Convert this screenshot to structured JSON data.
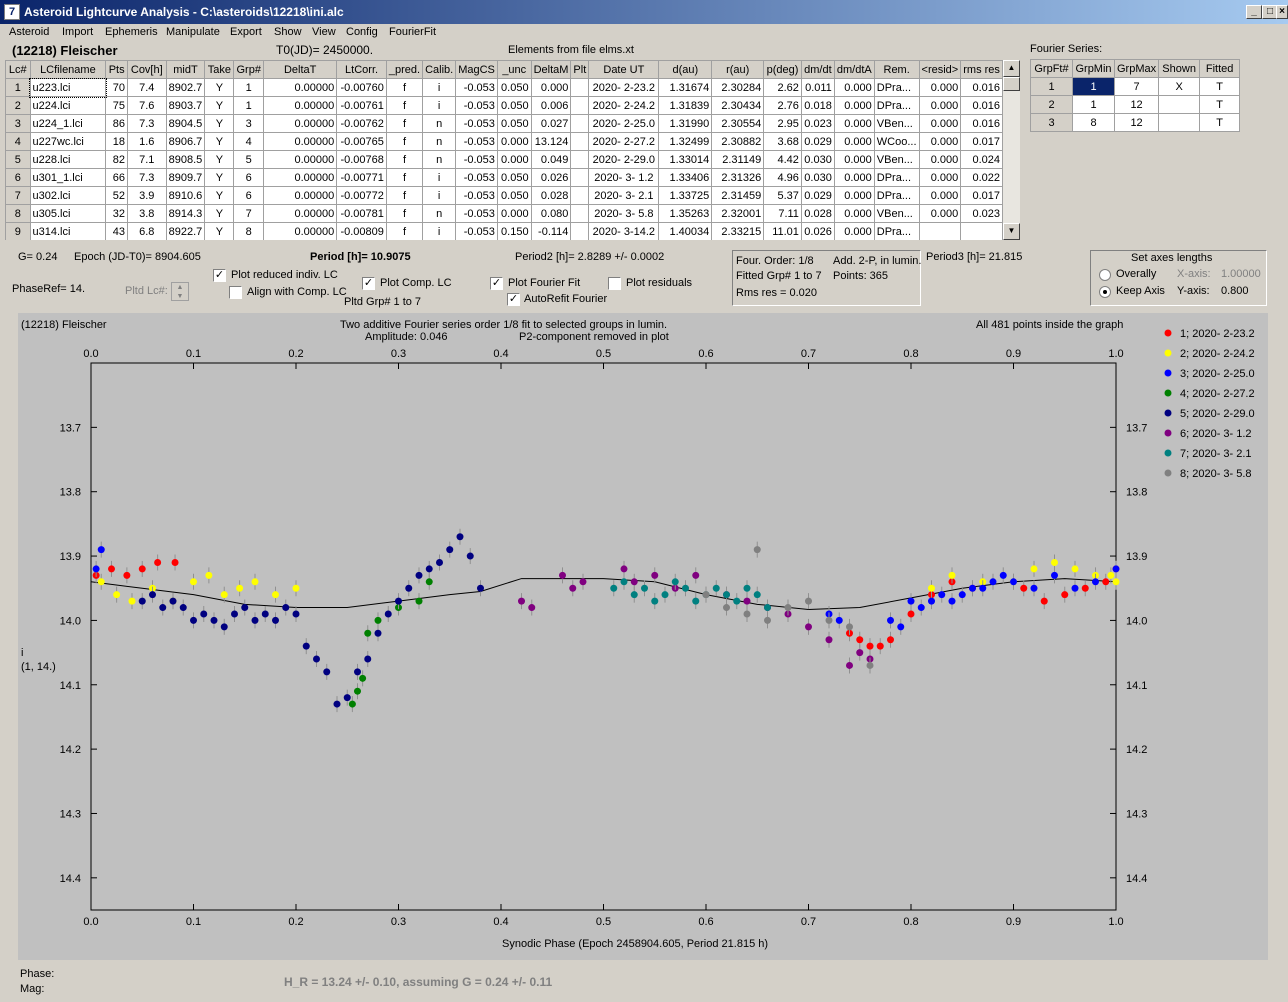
{
  "window": {
    "title": "Asteroid Lightcurve Analysis - C:\\asteroids\\12218\\ini.alc",
    "icon": "7"
  },
  "menu": [
    "Asteroid",
    "Import",
    "Ephemeris",
    "Manipulate",
    "Export",
    "Show",
    "View",
    "Config",
    "FourierFit"
  ],
  "header": {
    "asteroid": "(12218) Fleischer",
    "t0": "T0(JD)= 2450000.",
    "elements": "Elements from file elms.xt"
  },
  "lc_table": {
    "columns": [
      "Lc#",
      "LCfilename",
      "Pts",
      "Cov[h]",
      "midT",
      "Take",
      "Grp#",
      "DeltaT",
      "LtCorr.",
      "_pred.",
      "Calib.",
      "MagCS",
      "_unc",
      "DeltaM",
      "Plt",
      "Date UT",
      "d(au)",
      "r(au)",
      "p(deg)",
      "dm/dt",
      "dm/dtA",
      "Rem.",
      "<resid>",
      "rms res"
    ],
    "rows": [
      [
        "1",
        "u223.lci",
        "70",
        "7.4",
        "8902.7",
        "Y",
        "1",
        "0.00000",
        "-0.00760",
        "f",
        "i",
        "-0.053",
        "0.050",
        "0.000",
        "",
        "2020- 2-23.2",
        "1.31674",
        "2.30284",
        "2.62",
        "0.011",
        "0.000",
        "DPra...",
        "0.000",
        "0.016"
      ],
      [
        "2",
        "u224.lci",
        "75",
        "7.6",
        "8903.7",
        "Y",
        "1",
        "0.00000",
        "-0.00761",
        "f",
        "i",
        "-0.053",
        "0.050",
        "0.006",
        "",
        "2020- 2-24.2",
        "1.31839",
        "2.30434",
        "2.76",
        "0.018",
        "0.000",
        "DPra...",
        "0.000",
        "0.016"
      ],
      [
        "3",
        "u224_1.lci",
        "86",
        "7.3",
        "8904.5",
        "Y",
        "3",
        "0.00000",
        "-0.00762",
        "f",
        "n",
        "-0.053",
        "0.050",
        "0.027",
        "",
        "2020- 2-25.0",
        "1.31990",
        "2.30554",
        "2.95",
        "0.023",
        "0.000",
        "VBen...",
        "0.000",
        "0.016"
      ],
      [
        "4",
        "u227wc.lci",
        "18",
        "1.6",
        "8906.7",
        "Y",
        "4",
        "0.00000",
        "-0.00765",
        "f",
        "n",
        "-0.053",
        "0.000",
        "13.124",
        "",
        "2020- 2-27.2",
        "1.32499",
        "2.30882",
        "3.68",
        "0.029",
        "0.000",
        "WCoo...",
        "0.000",
        "0.017"
      ],
      [
        "5",
        "u228.lci",
        "82",
        "7.1",
        "8908.5",
        "Y",
        "5",
        "0.00000",
        "-0.00768",
        "f",
        "n",
        "-0.053",
        "0.000",
        "0.049",
        "",
        "2020- 2-29.0",
        "1.33014",
        "2.31149",
        "4.42",
        "0.030",
        "0.000",
        "VBen...",
        "0.000",
        "0.024"
      ],
      [
        "6",
        "u301_1.lci",
        "66",
        "7.3",
        "8909.7",
        "Y",
        "6",
        "0.00000",
        "-0.00771",
        "f",
        "i",
        "-0.053",
        "0.050",
        "0.026",
        "",
        "2020- 3- 1.2",
        "1.33406",
        "2.31326",
        "4.96",
        "0.030",
        "0.000",
        "DPra...",
        "0.000",
        "0.022"
      ],
      [
        "7",
        "u302.lci",
        "52",
        "3.9",
        "8910.6",
        "Y",
        "6",
        "0.00000",
        "-0.00772",
        "f",
        "i",
        "-0.053",
        "0.050",
        "0.028",
        "",
        "2020- 3- 2.1",
        "1.33725",
        "2.31459",
        "5.37",
        "0.029",
        "0.000",
        "DPra...",
        "0.000",
        "0.017"
      ],
      [
        "8",
        "u305.lci",
        "32",
        "3.8",
        "8914.3",
        "Y",
        "7",
        "0.00000",
        "-0.00781",
        "f",
        "n",
        "-0.053",
        "0.000",
        "0.080",
        "",
        "2020- 3- 5.8",
        "1.35263",
        "2.32001",
        "7.11",
        "0.028",
        "0.000",
        "VBen...",
        "0.000",
        "0.023"
      ],
      [
        "9",
        "u314.lci",
        "43",
        "6.8",
        "8922.7",
        "Y",
        "8",
        "0.00000",
        "-0.00809",
        "f",
        "i",
        "-0.053",
        "0.150",
        "-0.114",
        "",
        "2020- 3-14.2",
        "1.40034",
        "2.33215",
        "11.01",
        "0.026",
        "0.000",
        "DPra...",
        "",
        ""
      ]
    ]
  },
  "fourier": {
    "title": "Fourier Series:",
    "columns": [
      "GrpFt#",
      "GrpMin",
      "GrpMax",
      "Shown",
      "Fitted"
    ],
    "rows": [
      [
        "1",
        "1",
        "7",
        "X",
        "T"
      ],
      [
        "2",
        "1",
        "12",
        "",
        "T"
      ],
      [
        "3",
        "8",
        "12",
        "",
        "T"
      ]
    ]
  },
  "controls": {
    "g": "G= 0.24",
    "epoch": "Epoch (JD-T0)= 8904.605",
    "period": "Period [h]= 10.9075",
    "period2": "Period2 [h]= 2.8289 +/- 0.0002",
    "period3": "Period3 [h]= 21.815",
    "phaseref": "PhaseRef= 14.",
    "pltd_lc": "Pltd Lc#:",
    "plot_reduced": "Plot reduced indiv. LC",
    "align_comp": "Align with Comp. LC",
    "plot_comp": "Plot Comp. LC",
    "pltd_grp": "Pltd Grp#  1   to   7",
    "plot_fourier": "Plot Fourier Fit",
    "autorefit": "AutoRefit Fourier",
    "plot_resid": "Plot residuals",
    "four_order": "Four. Order:  1/8",
    "add2p": "Add. 2-P, in lumin.",
    "fitted_grp": "Fitted Grp# 1 to 7",
    "points": "Points: 365",
    "rms": "Rms res      = 0.020",
    "axes_title": "Set axes lengths",
    "overall": "Overally",
    "keep": "Keep Axis",
    "xaxis_lbl": "X-axis:",
    "xaxis_val": "1.00000",
    "yaxis_lbl": "Y-axis:",
    "yaxis_val": "0.800"
  },
  "plot": {
    "name": "(12218) Fleischer",
    "line1": "Two additive Fourier series order 1/8 fit to selected groups in lumin.",
    "line2": "Amplitude: 0.046",
    "line3": "P2-component removed in plot",
    "inside": "All 481 points inside the graph",
    "xlabel": "Synodic Phase (Epoch 2458904.605, Period 21.815 h)",
    "ylabel1": "i",
    "ylabel2": "(1, 14.)"
  },
  "footer": {
    "phase": "Phase:",
    "mag": "Mag:",
    "hr": "H_R = 13.24 +/- 0.10, assuming G = 0.24 +/- 0.11"
  },
  "chart_data": {
    "type": "scatter",
    "xlim": [
      0,
      1
    ],
    "ylim": [
      13.6,
      14.45
    ],
    "y_inverted": true,
    "xticks": [
      0.0,
      0.1,
      0.2,
      0.3,
      0.4,
      0.5,
      0.6,
      0.7,
      0.8,
      0.9,
      1.0
    ],
    "yticks": [
      13.7,
      13.8,
      13.9,
      14.0,
      14.1,
      14.2,
      14.3,
      14.4
    ],
    "series": [
      {
        "name": "1; 2020- 2-23.2",
        "color": "#ff0000",
        "x": [
          0.005,
          0.02,
          0.035,
          0.05,
          0.065,
          0.082,
          0.8,
          0.82,
          0.84,
          0.86,
          0.75,
          0.76,
          0.77,
          0.78,
          0.74,
          0.95,
          0.97,
          0.99,
          1.0,
          0.93,
          0.91
        ],
        "y": [
          13.93,
          13.92,
          13.93,
          13.92,
          13.91,
          13.91,
          13.99,
          13.96,
          13.94,
          13.95,
          14.03,
          14.04,
          14.04,
          14.03,
          14.02,
          13.96,
          13.95,
          13.94,
          13.92,
          13.97,
          13.95
        ]
      },
      {
        "name": "2; 2020- 2-24.2",
        "color": "#ffff00",
        "x": [
          0.01,
          0.025,
          0.04,
          0.06,
          0.08,
          0.1,
          0.115,
          0.13,
          0.145,
          0.16,
          0.18,
          0.2,
          0.82,
          0.84,
          0.87,
          0.9,
          0.92,
          0.94,
          0.96,
          0.98,
          1.0,
          0.995
        ],
        "y": [
          13.94,
          13.96,
          13.97,
          13.95,
          13.97,
          13.94,
          13.93,
          13.96,
          13.95,
          13.94,
          13.96,
          13.95,
          13.95,
          13.93,
          13.94,
          13.94,
          13.92,
          13.91,
          13.92,
          13.93,
          13.94,
          13.93
        ]
      },
      {
        "name": "3; 2020- 2-25.0",
        "color": "#0000ff",
        "x": [
          0.005,
          0.01,
          0.8,
          0.81,
          0.82,
          0.83,
          0.84,
          0.85,
          0.86,
          0.87,
          0.88,
          0.89,
          0.9,
          0.92,
          0.94,
          0.96,
          0.98,
          1.0,
          0.72,
          0.73,
          0.78,
          0.79
        ],
        "y": [
          13.92,
          13.89,
          13.97,
          13.98,
          13.97,
          13.96,
          13.97,
          13.96,
          13.95,
          13.95,
          13.94,
          13.93,
          13.94,
          13.95,
          13.93,
          13.95,
          13.94,
          13.92,
          13.99,
          14.0,
          14.0,
          14.01
        ]
      },
      {
        "name": "4; 2020- 2-27.2",
        "color": "#008000",
        "x": [
          0.27,
          0.28,
          0.3,
          0.32,
          0.33,
          0.255,
          0.26,
          0.265
        ],
        "y": [
          14.02,
          14.0,
          13.98,
          13.97,
          13.94,
          14.13,
          14.11,
          14.09
        ]
      },
      {
        "name": "5; 2020- 2-29.0",
        "color": "#000080",
        "x": [
          0.05,
          0.06,
          0.07,
          0.08,
          0.09,
          0.1,
          0.11,
          0.12,
          0.13,
          0.14,
          0.15,
          0.16,
          0.17,
          0.18,
          0.19,
          0.2,
          0.21,
          0.22,
          0.23,
          0.24,
          0.25,
          0.26,
          0.27,
          0.28,
          0.29,
          0.3,
          0.31,
          0.32,
          0.33,
          0.34,
          0.35,
          0.36,
          0.37,
          0.38
        ],
        "y": [
          13.97,
          13.96,
          13.98,
          13.97,
          13.98,
          14.0,
          13.99,
          14.0,
          14.01,
          13.99,
          13.98,
          14.0,
          13.99,
          14.0,
          13.98,
          13.99,
          14.04,
          14.06,
          14.08,
          14.13,
          14.12,
          14.08,
          14.06,
          14.02,
          13.99,
          13.97,
          13.95,
          13.93,
          13.92,
          13.91,
          13.89,
          13.87,
          13.9,
          13.95
        ]
      },
      {
        "name": "6; 2020- 3- 1.2",
        "color": "#800080",
        "x": [
          0.42,
          0.43,
          0.46,
          0.47,
          0.48,
          0.52,
          0.53,
          0.55,
          0.57,
          0.59,
          0.62,
          0.64,
          0.66,
          0.68,
          0.7,
          0.72,
          0.74,
          0.75,
          0.76
        ],
        "y": [
          13.97,
          13.98,
          13.93,
          13.95,
          13.94,
          13.92,
          13.94,
          13.93,
          13.95,
          13.93,
          13.96,
          13.97,
          13.98,
          13.99,
          14.01,
          14.03,
          14.07,
          14.05,
          14.06
        ]
      },
      {
        "name": "7; 2020- 3- 2.1",
        "color": "#008080",
        "x": [
          0.51,
          0.52,
          0.53,
          0.54,
          0.55,
          0.56,
          0.57,
          0.58,
          0.59,
          0.6,
          0.61,
          0.62,
          0.63,
          0.64,
          0.65,
          0.66
        ],
        "y": [
          13.95,
          13.94,
          13.96,
          13.95,
          13.97,
          13.96,
          13.94,
          13.95,
          13.97,
          13.96,
          13.95,
          13.96,
          13.97,
          13.95,
          13.96,
          13.98
        ]
      },
      {
        "name": "8; 2020- 3- 5.8",
        "color": "#808080",
        "x": [
          0.6,
          0.62,
          0.64,
          0.66,
          0.68,
          0.7,
          0.72,
          0.74,
          0.76,
          0.65
        ],
        "y": [
          13.96,
          13.98,
          13.99,
          14.0,
          13.98,
          13.97,
          14.0,
          14.01,
          14.07,
          13.89
        ]
      }
    ],
    "fit": {
      "x": [
        0.0,
        0.05,
        0.1,
        0.15,
        0.2,
        0.25,
        0.3,
        0.35,
        0.38,
        0.42,
        0.5,
        0.55,
        0.6,
        0.65,
        0.7,
        0.75,
        0.8,
        0.85,
        0.9,
        0.95,
        1.0
      ],
      "y": [
        13.94,
        13.95,
        13.96,
        13.975,
        13.98,
        13.98,
        13.97,
        13.96,
        13.955,
        13.935,
        13.935,
        13.94,
        13.96,
        13.975,
        13.983,
        13.98,
        13.965,
        13.95,
        13.94,
        13.935,
        13.94
      ]
    }
  }
}
